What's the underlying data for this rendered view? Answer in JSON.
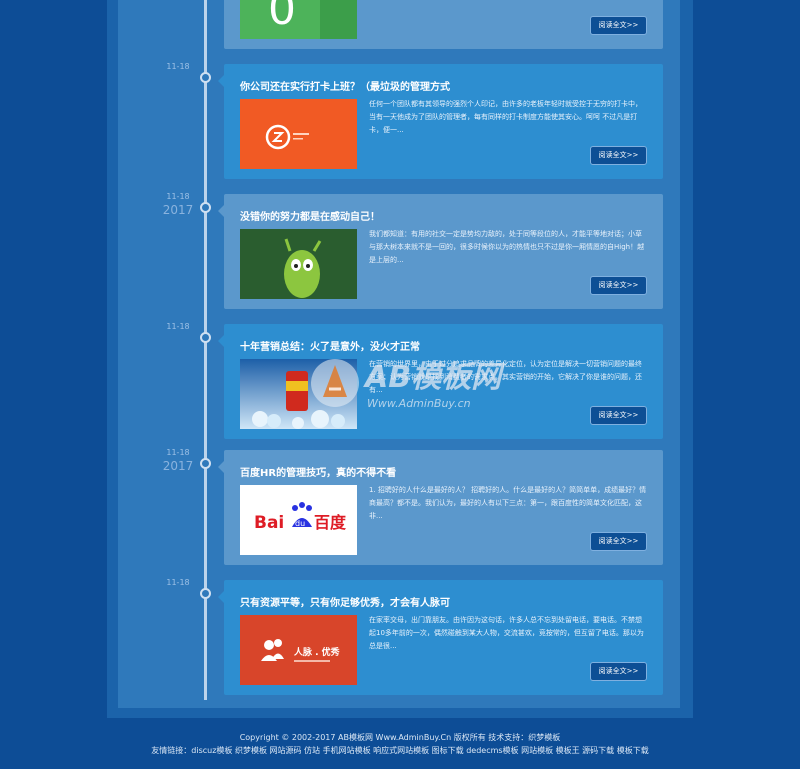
{
  "timeline": [
    {
      "date": "",
      "year": "",
      "title": "",
      "excerpt": "",
      "more_label": "阅读全文>>",
      "thumb": "green-number",
      "variant": "light"
    },
    {
      "date": "11-18",
      "year": "",
      "title": "你公司还在实行打卡上班？（最垃圾的管理方式",
      "excerpt": "任何一个团队都有其领导的强烈个人印记，由许多的老板年轻时就受控于无穷的打卡中，当有一天他成为了团队的管理者，每有同样的打卡制度方能使其安心。呵呵 不过凡是打卡，便一...",
      "more_label": "阅读全文>>",
      "thumb": "orange-logo",
      "variant": "dark"
    },
    {
      "date": "11-18",
      "year": "2017",
      "title": "没错你的努力都是在感动自己！",
      "excerpt": "我们都知道：有用的社交一定是势均力敌的，处于同等段位的人，才能平等地对话；小草与那大树本来就不是一回的，很多时候你以为的热情也只不过是你一厢情愿的自High！越是上层的...",
      "more_label": "阅读全文>>",
      "thumb": "green-creature",
      "variant": "light"
    },
    {
      "date": "11-18",
      "year": "",
      "title": "十年营销总结：火了是意外，没火才正常",
      "excerpt": "在营销的世界里，由于过分追求品牌的差异化定位，认为定位是解决一切营销问题的最终方案；认为营销就是找到消费者的需求点，其实营销的开始，它解决了你是谁的问题，还有...",
      "more_label": "阅读全文>>",
      "thumb": "can-ice",
      "variant": "dark"
    },
    {
      "date": "11-18",
      "year": "2017",
      "title": "百度HR的管理技巧，真的不得不看",
      "excerpt": "1. 招聘好的人什么是最好的人？ 招聘好的人。什么是最好的人？简简单单，成绩最好？情商最高？都不是。我们认为，最好的人有以下三点：第一，跟百度性的简单文化匹配，这非...",
      "more_label": "阅读全文>>",
      "thumb": "baidu",
      "variant": "light"
    },
    {
      "date": "11-18",
      "year": "",
      "title": "只有资源平等，只有你足够优秀，才会有人脉可",
      "excerpt": "在家率交母，出门靠朋友。由许因为这句话，许多人总不忘到处留电话，要电话。不禁想起10多年前的一次，偶然碰触到某大人物，交流甚欢，竞按常的，但互留了电话。那以为总是很...",
      "more_label": "阅读全文>>",
      "thumb": "red-people",
      "variant": "dark"
    }
  ],
  "thumb_text": {
    "number": "0",
    "baidu_bai": "Bai",
    "baidu_du": "du",
    "baidu_cn": "百度",
    "people_brand": "人脉 . 优秀"
  },
  "watermark": {
    "brand": "AB模板网",
    "url": "Www.AdminBuy.cn"
  },
  "footer": {
    "copyright": "Copyright © 2002-2017 AB模板网 Www.AdminBuy.Cn 版权所有 技术支持：织梦模板",
    "links": "友情链接：discuz模板 织梦模板 网站源码 仿站 手机网站模板 响应式网站模板 图标下载 dedecms模板 网站模板 模板王 源码下载 模板下载"
  },
  "colors": {
    "page_bg": "#0d4d96",
    "card_light": "#5b98cc",
    "card_dark": "#2d8ed0",
    "button": "#0d4f95"
  }
}
